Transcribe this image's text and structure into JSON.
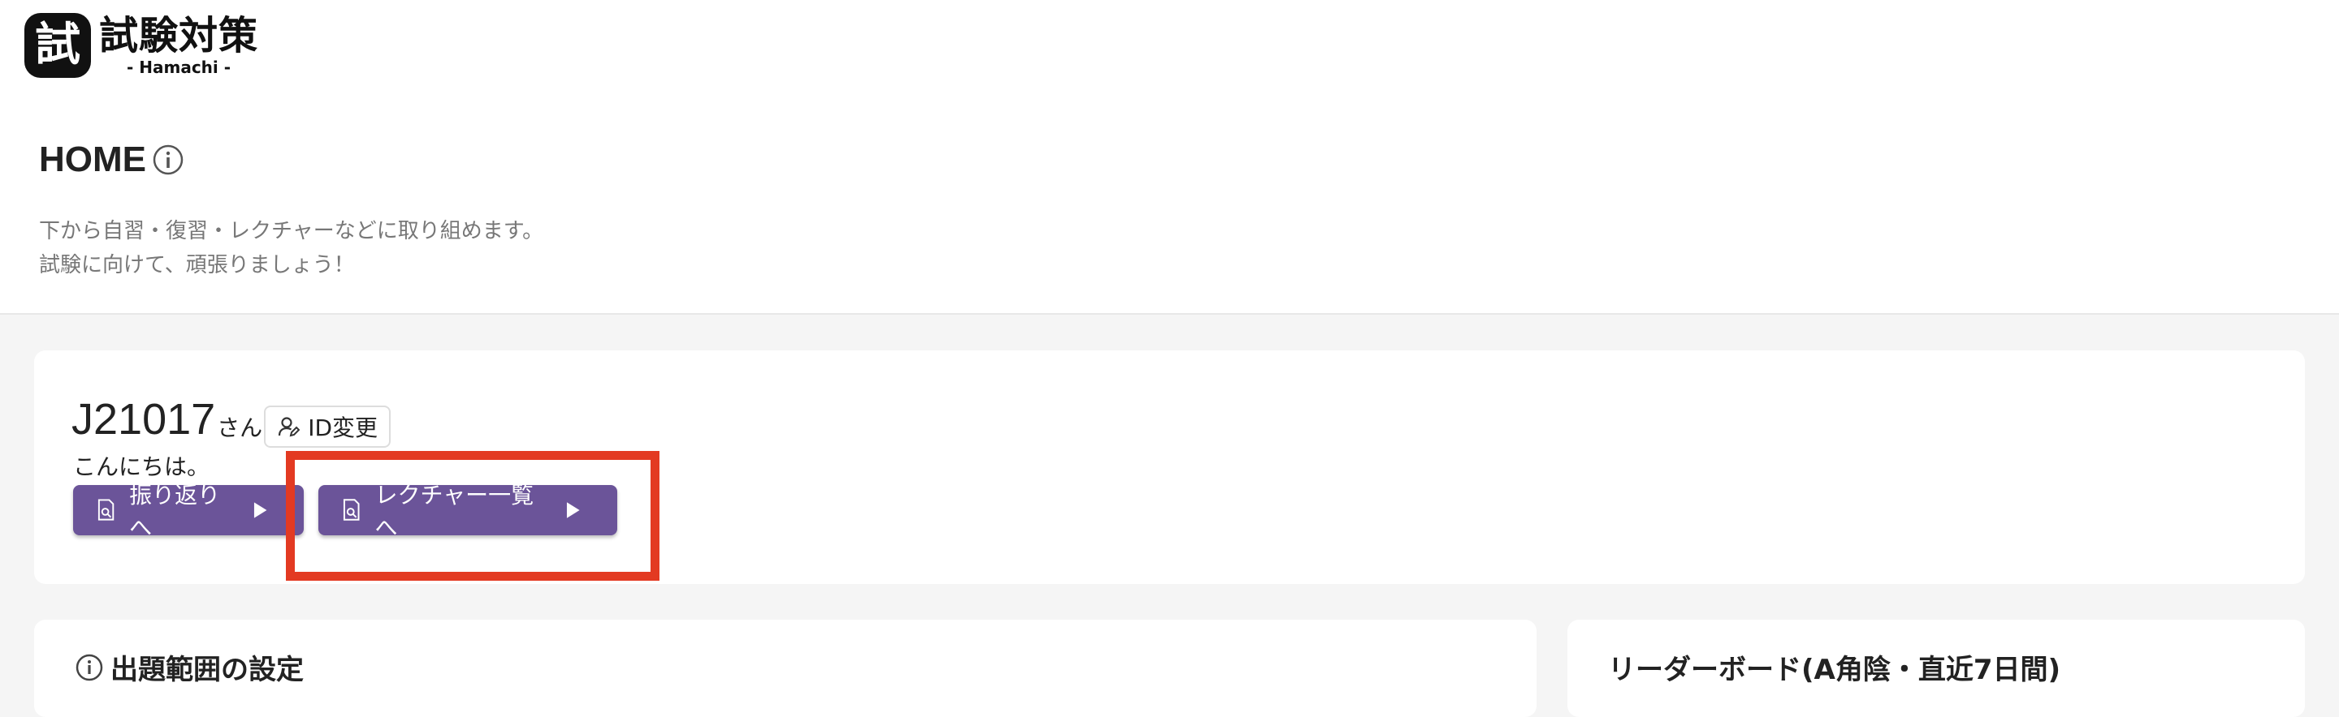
{
  "app": {
    "logo_mark": "試",
    "logo_title": "試験対策",
    "logo_sub": "- Hamachi -"
  },
  "header": {
    "title": "HOME",
    "description_line1": "下から自習・復習・レクチャーなどに取り組めます。",
    "description_line2": "試験に向けて、頑張りましょう！"
  },
  "user": {
    "id": "J21017",
    "suffix": "さん",
    "id_change_label": "ID変更",
    "greeting": "こんにちは。"
  },
  "actions": {
    "review_label": "振り返りへ",
    "lectures_label": "レクチャー一覧へ"
  },
  "sections": {
    "range_title": "出題範囲の設定",
    "leaderboard_title": "リーダーボード(A角陰・直近7日間)"
  },
  "colors": {
    "primary": "#6b5499",
    "highlight": "#e33a22",
    "background": "#f5f5f5"
  }
}
